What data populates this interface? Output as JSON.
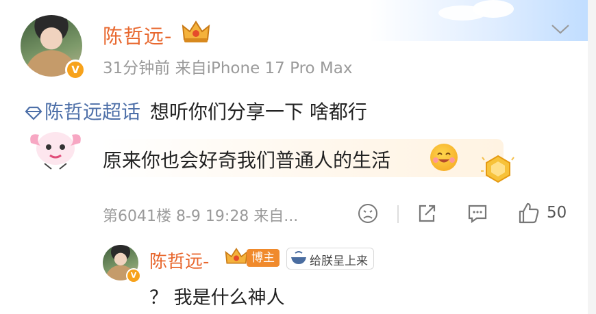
{
  "post": {
    "author": "陈哲远-",
    "verified_badge": "V",
    "meta": "31分钟前  来自iPhone 17 Pro Max",
    "topic": "陈哲远超话",
    "text": "想听你们分享一下 啥都行"
  },
  "comment": {
    "text": "原来你也会好奇我们普通人的生活",
    "floor_info": "第6041楼  8-9 19:28  来自...",
    "like_count": "50"
  },
  "reply": {
    "author": "陈哲远-",
    "role_tag": "博主",
    "fans_tag": "给朕呈上来",
    "text": "？ 我是什么神人"
  },
  "icons": [
    "chevron-down-icon",
    "topic-diamond-icon",
    "sad-face-icon",
    "share-icon",
    "comment-icon",
    "thumbs-up-icon",
    "crown-icon",
    "bowl-icon",
    "gold-medal-icon"
  ],
  "colors": {
    "name_orange": "#e8682f",
    "topic_blue": "#4d6fa8",
    "meta_gray": "#9a9a9a"
  }
}
